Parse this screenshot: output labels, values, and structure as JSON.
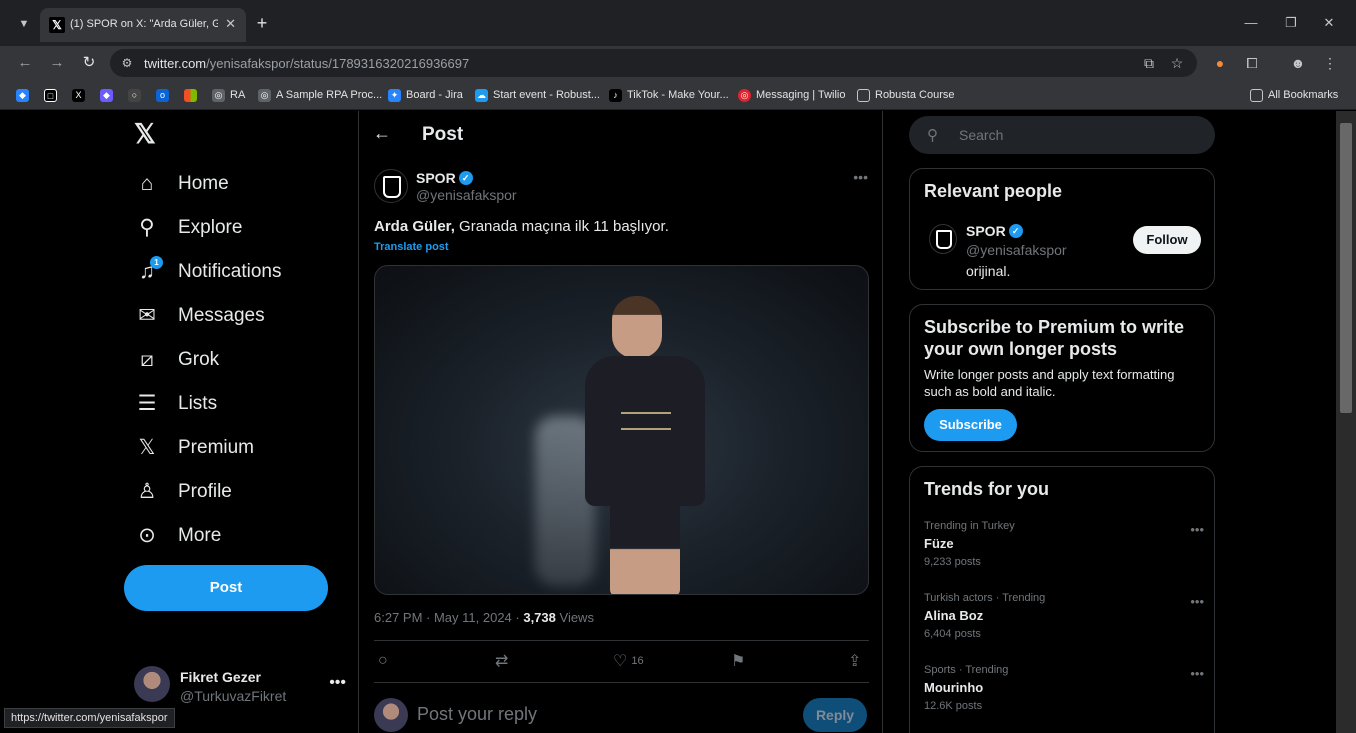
{
  "browser": {
    "tab_title": "(1) SPOR on X: \"Arda Güler, Gra",
    "url_domain": "twitter.com",
    "url_path": "/yenisafakspor/status/1789316320216936697",
    "bookmarks": [
      "RA",
      "A Sample RPA Proc...",
      "Board - Jira",
      "Start event - Robust...",
      "TikTok - Make Your...",
      "Messaging | Twilio",
      "Robusta Course"
    ],
    "all_bookmarks": "All Bookmarks",
    "status_url": "https://twitter.com/yenisafakspor"
  },
  "nav": {
    "items": [
      {
        "label": "Home",
        "icon": "home-icon"
      },
      {
        "label": "Explore",
        "icon": "search-icon"
      },
      {
        "label": "Notifications",
        "icon": "bell-icon",
        "badge": "1"
      },
      {
        "label": "Messages",
        "icon": "mail-icon"
      },
      {
        "label": "Grok",
        "icon": "grok-icon"
      },
      {
        "label": "Lists",
        "icon": "list-icon"
      },
      {
        "label": "Premium",
        "icon": "x-icon"
      },
      {
        "label": "Profile",
        "icon": "person-icon"
      },
      {
        "label": "More",
        "icon": "more-circle-icon"
      }
    ],
    "post_button": "Post"
  },
  "account": {
    "name": "Fikret Gezer",
    "handle": "@TurkuvazFikret"
  },
  "main": {
    "header": "Post",
    "author_name": "SPOR",
    "author_handle": "@yenisafakspor",
    "text_bold": "Arda Güler,",
    "text_rest": " Granada maçına ilk 11 başlıyor.",
    "translate": "Translate post",
    "meta_time": "6:27 PM · May 11, 2024 · ",
    "meta_views": "3,738",
    "meta_views_label": " Views",
    "likes": "16",
    "reply_placeholder": "Post your reply",
    "reply_button": "Reply"
  },
  "right": {
    "search_placeholder": "Search",
    "relevant_title": "Relevant people",
    "rp_name": "SPOR",
    "rp_handle": "@yenisafakspor",
    "rp_bio": "orijinal.",
    "follow": "Follow",
    "premium_title": "Subscribe to Premium to write your own longer posts",
    "premium_text": "Write longer posts and apply text formatting such as bold and italic.",
    "subscribe": "Subscribe",
    "trends_title": "Trends for you",
    "trends": [
      {
        "context": "Trending in Turkey",
        "name": "Füze",
        "count": "9,233 posts"
      },
      {
        "context": "Turkish actors · Trending",
        "name": "Alina Boz",
        "count": "6,404 posts"
      },
      {
        "context": "Sports · Trending",
        "name": "Mourinho",
        "count": "12.6K posts"
      }
    ]
  },
  "colors": {
    "accent": "#1d9bf0",
    "background": "#000000",
    "border": "#2f3336"
  }
}
